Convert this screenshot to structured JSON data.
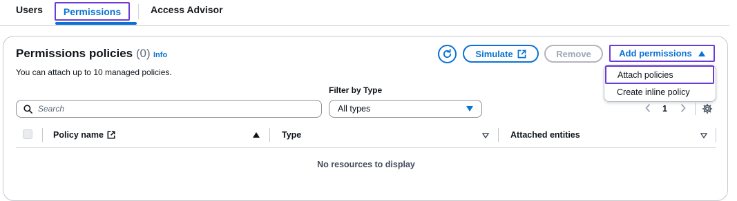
{
  "tabs": [
    {
      "label": "Users"
    },
    {
      "label": "Permissions"
    },
    {
      "label": "Access Advisor"
    }
  ],
  "panel": {
    "title": "Permissions policies",
    "count": "(0)",
    "info": "Info",
    "description": "You can attach up to 10 managed policies."
  },
  "actions": {
    "refresh_icon": "refresh-icon",
    "simulate": "Simulate",
    "remove": "Remove",
    "add_permissions": "Add permissions"
  },
  "add_menu": {
    "items": [
      {
        "label": "Attach policies"
      },
      {
        "label": "Create inline policy"
      }
    ]
  },
  "filters": {
    "search_placeholder": "Search",
    "filter_by_type_label": "Filter by Type",
    "type_selected": "All types"
  },
  "pagination": {
    "current_page": "1"
  },
  "table": {
    "columns": [
      {
        "label": "Policy name"
      },
      {
        "label": "Type"
      },
      {
        "label": "Attached entities"
      }
    ],
    "empty_message": "No resources to display"
  },
  "colors": {
    "accent": "#0972d3",
    "highlight": "#6b3bd6",
    "disabled": "#9ba7b6"
  }
}
